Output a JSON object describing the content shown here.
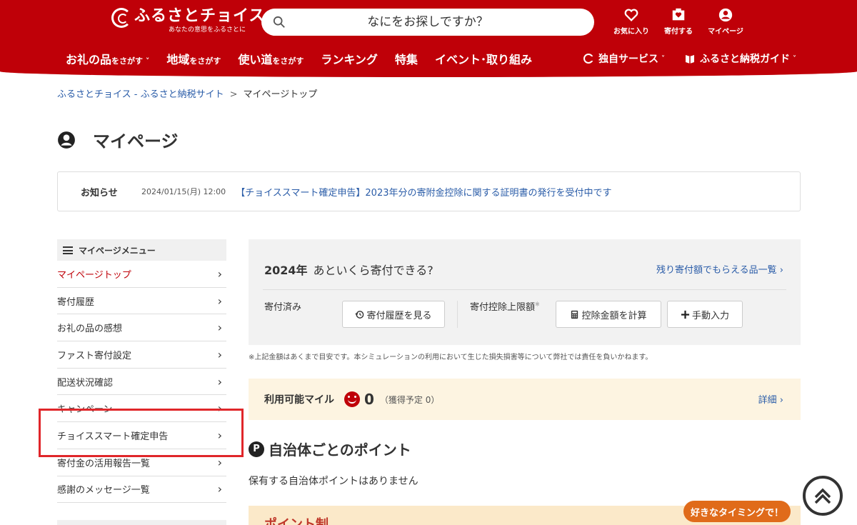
{
  "header": {
    "logo_title": "ふるさとチョイス",
    "logo_tagline": "あなたの意思をふるさとに",
    "search_placeholder": "なにをお探しですか？",
    "icons": {
      "favorites": "お気に入り",
      "donate": "寄付する",
      "mypage": "マイページ"
    },
    "nav": [
      {
        "main": "お礼の品",
        "sub": "をさがす"
      },
      {
        "main": "地域",
        "sub": "をさがす"
      },
      {
        "main": "使い道",
        "sub": "をさがす"
      },
      {
        "main": "ランキング",
        "sub": ""
      },
      {
        "main": "特集",
        "sub": ""
      },
      {
        "main": "イベント･取り組み",
        "sub": ""
      }
    ],
    "nav_services": "独自サービス",
    "nav_guide": "ふるさと納税ガイド"
  },
  "breadcrumb": {
    "home": "ふるさとチョイス - ふるさと納税サイト",
    "separator": ">",
    "current": "マイページトップ"
  },
  "page_title": "マイページ",
  "notice": {
    "label": "お知らせ",
    "date": "2024/01/15(月) 12:00",
    "text": "【チョイススマート確定申告】2023年分の寄附金控除に関する証明書の発行を受付中です"
  },
  "sidebar": {
    "heading": "マイページメニュー",
    "items": [
      "マイページトップ",
      "寄付履歴",
      "お礼の品の感想",
      "ファスト寄付設定",
      "配送状況確認",
      "キャンペーン",
      "チョイススマート確定申告",
      "寄付金の活用報告一覧",
      "感謝のメッセージ一覧"
    ],
    "chevron": "›"
  },
  "simulator": {
    "year": "2024年",
    "question": "あといくら寄付できる?",
    "link": "残り寄付額でもらえる品一覧",
    "donated_label": "寄付済み",
    "history_button": "寄付履歴を見る",
    "limit_label": "寄付控除上限額",
    "limit_mark": "※",
    "calc_button": "控除金額を計算",
    "manual_button": "手動入力",
    "note": "※上記金額はあくまで目安です。本シミュレーションの利用において生じた損失損害等について弊社では責任を負いかねます。"
  },
  "mile": {
    "label": "利用可能マイル",
    "value": "0",
    "pending": "（獲得予定 0）",
    "detail": "詳細"
  },
  "points": {
    "badge": "P",
    "title": "自治体ごとのポイント",
    "empty": "保有する自治体ポイントはありません"
  },
  "banner": {
    "text": "ポイント制",
    "tag": "好きなタイミングで！"
  },
  "colors": {
    "brand_red": "#bf0008",
    "link_blue": "#2a5ca8",
    "highlight": "#e0262a"
  }
}
